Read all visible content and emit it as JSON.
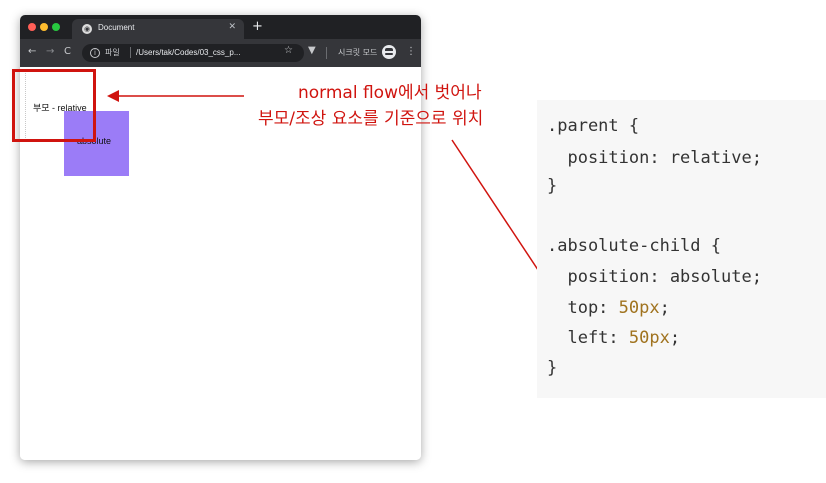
{
  "browser": {
    "tab": {
      "title": "Document",
      "close_icon": "✕",
      "favicon_icon": "globe-icon"
    },
    "new_tab_label": "+",
    "toolbar": {
      "back_label": "←",
      "forward_label": "→",
      "reload_label": "C",
      "scheme_label": "파일",
      "url": "/Users/tak/Codes/03_css_p...",
      "star_label": "☆",
      "extension_label": "▼",
      "incognito_label": "시크릿 모드",
      "menu_label": "⋮"
    },
    "page": {
      "parent_label": "부모 - relative",
      "child_label": "absolute"
    }
  },
  "annotation": {
    "line1": "normal flow에서 벗어나",
    "line2": "부모/조상 요소를 기준으로 위치",
    "color": "#d0140f"
  },
  "code": {
    "lines": [
      ".parent {",
      "  position: relative;",
      "}",
      "",
      ".absolute-child {",
      "  position: absolute;",
      "  top: ",
      "50px",
      ";",
      "  left: ",
      "50px",
      ";",
      "}"
    ],
    "number_color": "#a0731f"
  },
  "colors": {
    "child_box": "#9b7cf7",
    "browser_chrome": "#35363a"
  }
}
